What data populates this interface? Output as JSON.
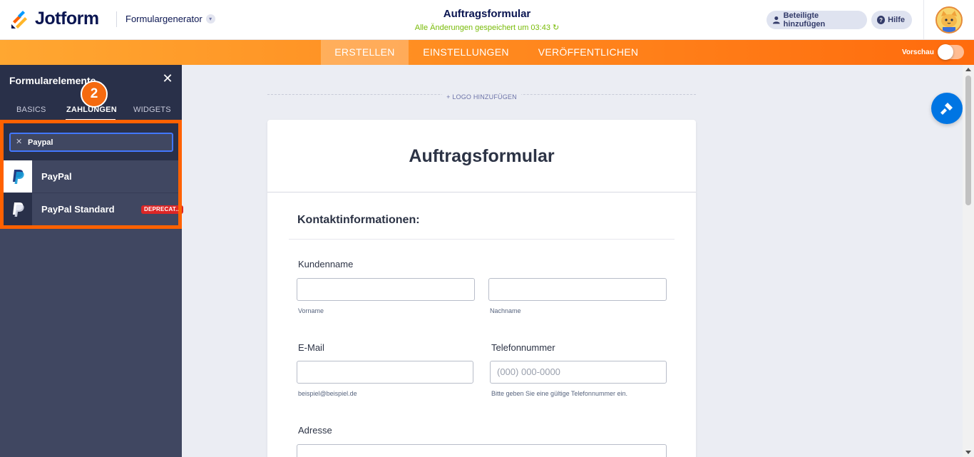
{
  "header": {
    "brand": "Jotform",
    "generator_label": "Formulargenerator",
    "form_title": "Auftragsformular",
    "saved_status": "Alle Änderungen gespeichert um 03:43",
    "add_participants": "Beteiligte hinzufügen",
    "help": "Hilfe"
  },
  "nav": {
    "tabs": [
      "ERSTELLEN",
      "EINSTELLUNGEN",
      "VERÖFFENTLICHEN"
    ],
    "active_tab": "ERSTELLEN",
    "preview_label": "Vorschau",
    "preview_enabled": false
  },
  "panel": {
    "title": "Formularelemente",
    "step_badge": "2",
    "tabs": [
      "BASICS",
      "ZAHLUNGEN",
      "WIDGETS"
    ],
    "active_tab": "ZAHLUNGEN",
    "search_value": "Paypal",
    "items": [
      {
        "label": "PayPal",
        "icon": "paypal-icon"
      },
      {
        "label": "PayPal Standard",
        "icon": "paypal-icon",
        "badge": "DEPRECAT..."
      }
    ]
  },
  "canvas": {
    "add_logo": "+ LOGO HINZUFÜGEN",
    "form_title": "Auftragsformular",
    "section_title": "Kontaktinformationen:",
    "fields": {
      "name_label": "Kundenname",
      "first_name_sub": "Vorname",
      "last_name_sub": "Nachname",
      "email_label": "E-Mail",
      "email_sub": "beispiel@beispiel.de",
      "phone_label": "Telefonnummer",
      "phone_placeholder": "(000) 000-0000",
      "phone_sub": "Bitte geben Sie eine gültige Telefonnummer ein.",
      "address_label": "Adresse"
    }
  },
  "colors": {
    "accent_orange": "#ff6100",
    "primary_blue": "#0075e3",
    "saved_green": "#78bb07",
    "panel_bg": "#404761"
  }
}
